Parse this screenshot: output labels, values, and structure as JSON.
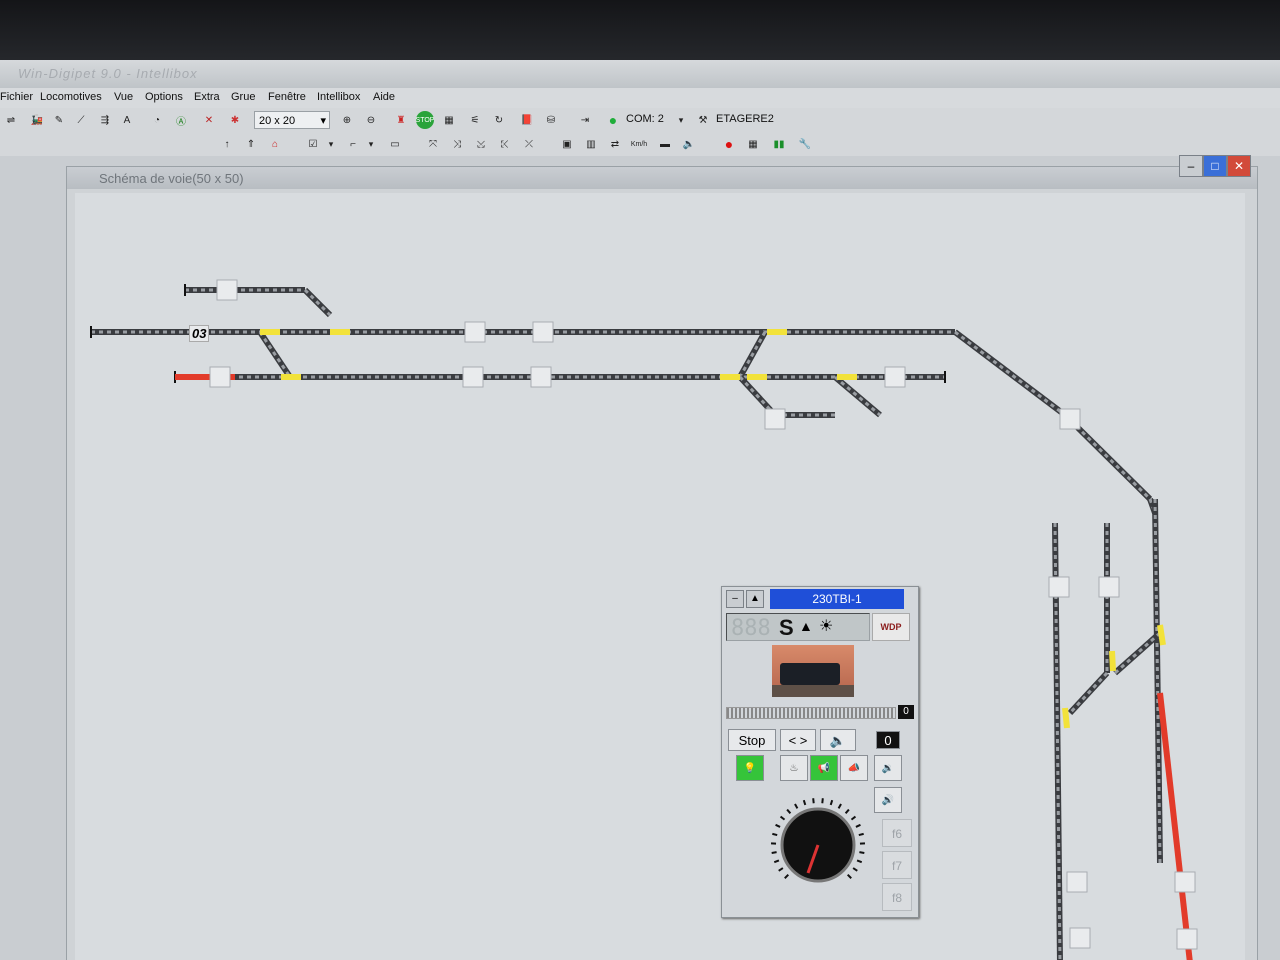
{
  "app": {
    "title": "Win-Digipet 9.0 - Intellibox"
  },
  "menu": [
    "Fichier",
    "Locomotives",
    "Vue",
    "Options",
    "Extra",
    "Grue",
    "Fenêtre",
    "Intellibox",
    "Aide"
  ],
  "toolbar": {
    "grid_size": "20 x 20",
    "com_label": "COM: 2",
    "profile": "ETAGERE2"
  },
  "layout_window": {
    "title": "Schéma de voie(50 x 50)",
    "block_number": "03"
  },
  "loco_panel": {
    "name": "230TBI-1",
    "direction": "S",
    "display_digits": "888",
    "speed_value": "0",
    "stop_label": "Stop",
    "reverse_label": "< >",
    "counter": "0",
    "logo": "WDP",
    "f_keys": [
      "f6",
      "f7",
      "f8"
    ]
  },
  "colors": {
    "occupied": "#e23b2a",
    "turnout": "#f2e23a",
    "track": "#3a3c40",
    "selected_title": "#1f4fd8"
  }
}
